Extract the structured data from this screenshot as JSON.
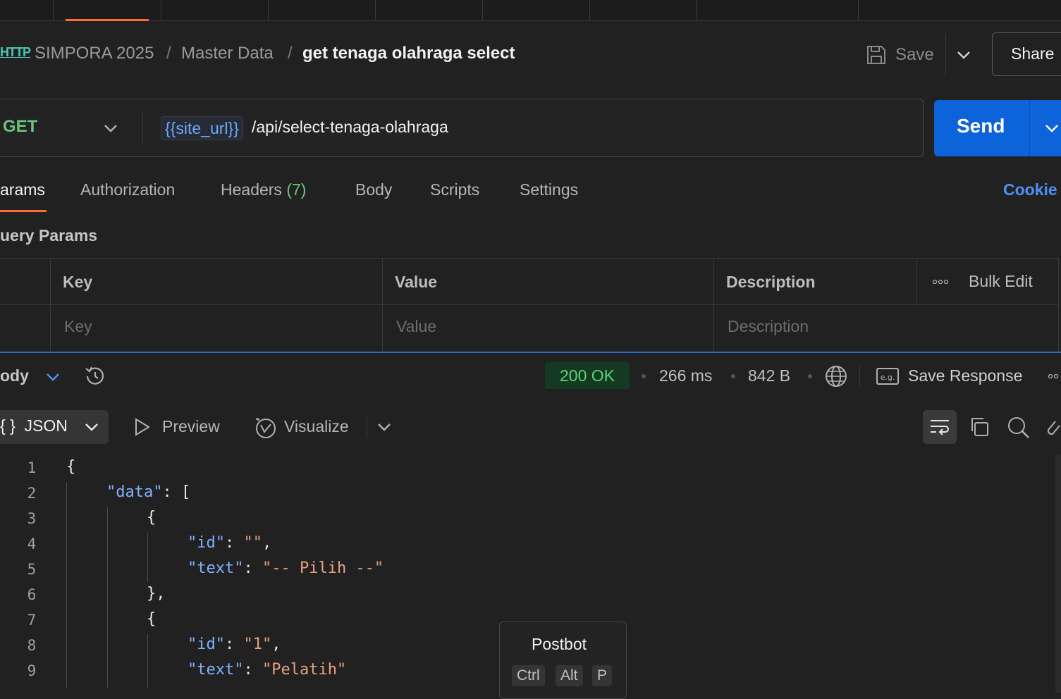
{
  "breadcrumb": {
    "protocol_icon": "HTTP",
    "collection": "SIMPORA 2025",
    "folder": "Master Data",
    "sep": "/",
    "request_name": "get tenaga olahraga select"
  },
  "header_actions": {
    "save_label": "Save",
    "share_label": "Share"
  },
  "request": {
    "method": "GET",
    "url_variable": "{{site_url}}",
    "url_path": "/api/select-tenaga-olahraga",
    "send_label": "Send"
  },
  "request_tabs": {
    "params": "arams",
    "authorization": "Authorization",
    "headers": "Headers",
    "headers_count": "(7)",
    "body": "Body",
    "scripts": "Scripts",
    "settings": "Settings",
    "cookies": "Cookie"
  },
  "query_params": {
    "title": "uery Params",
    "columns": [
      "Key",
      "Value",
      "Description"
    ],
    "bulk_edit": "Bulk Edit",
    "placeholders": [
      "Key",
      "Value",
      "Description"
    ]
  },
  "response": {
    "body_label": "ody",
    "status": "200 OK",
    "time": "266 ms",
    "size": "842 B",
    "save_response": "Save Response",
    "format": "JSON",
    "format_icon": "{ }",
    "preview": "Preview",
    "visualize": "Visualize",
    "status_color": "#5cd47a"
  },
  "code": {
    "line_numbers": [
      "1",
      "2",
      "3",
      "4",
      "5",
      "6",
      "7",
      "8",
      "9"
    ],
    "l1": "{",
    "l2_key": "\"data\"",
    "l2_rest": ": [",
    "l3": "{",
    "l4_key": "\"id\"",
    "l4_colon": ": ",
    "l4_val": "\"\"",
    "l4_end": ",",
    "l5_key": "\"text\"",
    "l5_colon": ": ",
    "l5_val": "\"-- Pilih --\"",
    "l6": "},",
    "l7": "{",
    "l8_key": "\"id\"",
    "l8_colon": ": ",
    "l8_val": "\"1\"",
    "l8_end": ",",
    "l9_key": "\"text\"",
    "l9_colon": ": ",
    "l9_val": "\"Pelatih\""
  },
  "postbot": {
    "title": "Postbot",
    "keys": [
      "Ctrl",
      "Alt",
      "P"
    ]
  },
  "colors": {
    "accent_orange": "#ff6c37",
    "send_blue": "#0d63d9",
    "link_blue": "#4f8ff7"
  }
}
